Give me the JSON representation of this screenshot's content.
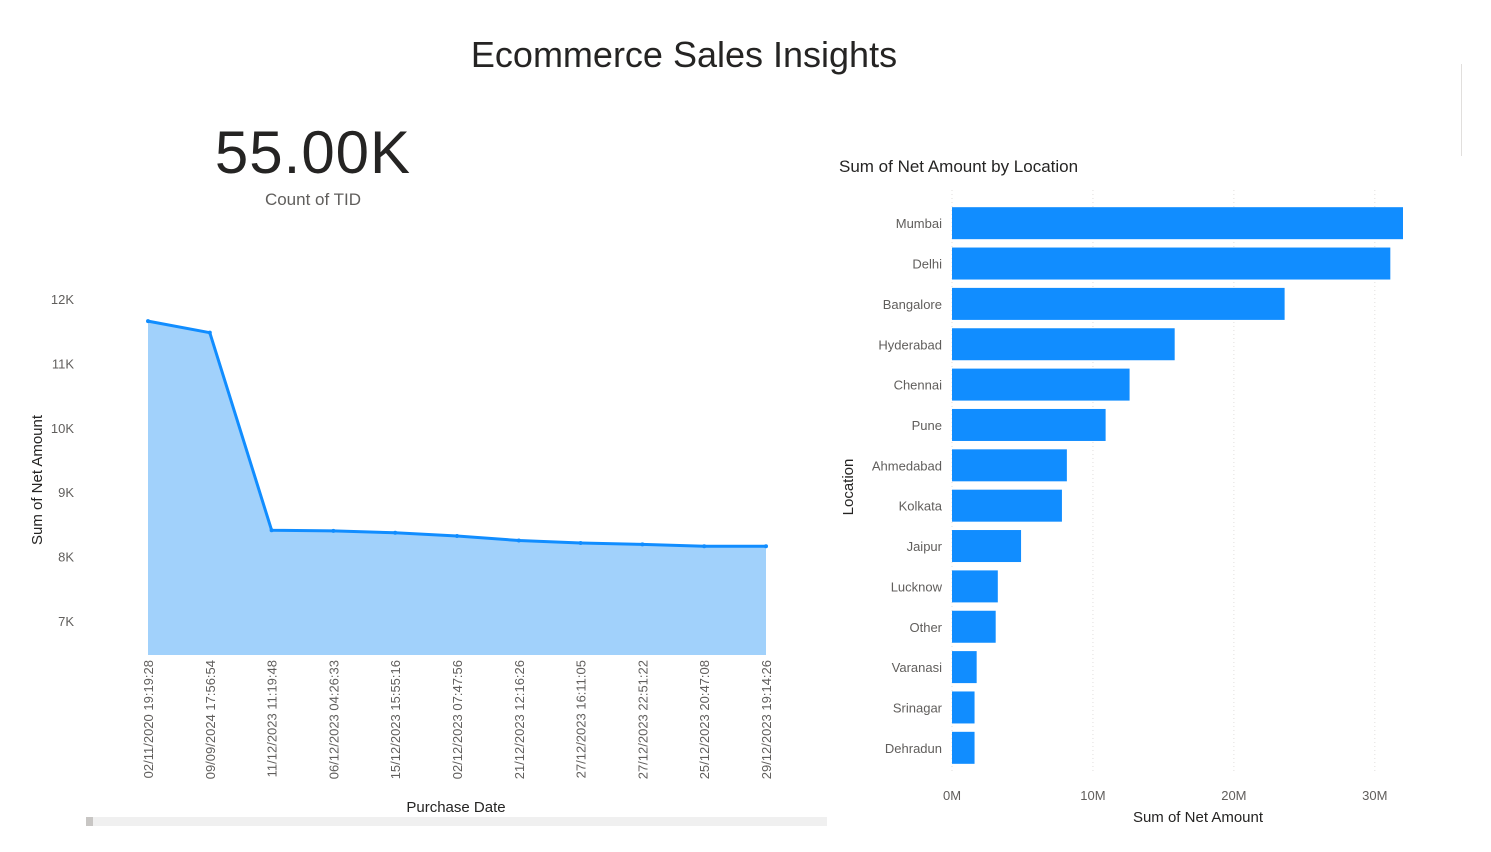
{
  "report": {
    "title": "Ecommerce Sales Insights"
  },
  "kpi": {
    "value": "55.00K",
    "label": "Count of TID"
  },
  "colors": {
    "bar": "#118dff",
    "area_fill": "#a1d1fb",
    "area_line": "#118dff",
    "grid": "#e1dfdd"
  },
  "chart_data": [
    {
      "type": "area",
      "title": "",
      "xlabel": "Purchase Date",
      "ylabel": "Sum of Net Amount",
      "x": [
        "02/11/2020 19:19:28",
        "09/09/2024 17:56:54",
        "11/12/2023 11:19:48",
        "06/12/2023 04:26:33",
        "15/12/2023 15:55:16",
        "02/12/2023 07:47:56",
        "21/12/2023 12:16:26",
        "27/12/2023 16:11:05",
        "27/12/2023 22:51:22",
        "25/12/2023 20:47:08",
        "29/12/2023 19:14:26"
      ],
      "values": [
        11660,
        11480,
        8410,
        8400,
        8370,
        8320,
        8250,
        8210,
        8190,
        8160,
        8160
      ],
      "yticks": [
        12000,
        11000,
        10000,
        9000,
        8000,
        7000
      ],
      "ytick_labels": [
        "12K",
        "11K",
        "10K",
        "9K",
        "8K",
        "7K"
      ],
      "ylim": [
        6470,
        12330
      ],
      "grid": false
    },
    {
      "type": "bar",
      "orientation": "horizontal",
      "title": "Sum of Net Amount by Location",
      "xlabel": "Sum of Net Amount",
      "ylabel": "Location",
      "categories": [
        "Mumbai",
        "Delhi",
        "Bangalore",
        "Hyderabad",
        "Chennai",
        "Pune",
        "Ahmedabad",
        "Kolkata",
        "Jaipur",
        "Lucknow",
        "Other",
        "Varanasi",
        "Srinagar",
        "Dehradun"
      ],
      "values": [
        32000000,
        31100000,
        23600000,
        15800000,
        12600000,
        10900000,
        8150000,
        7800000,
        4900000,
        3250000,
        3100000,
        1750000,
        1600000,
        1600000
      ],
      "xticks": [
        0,
        10000000,
        20000000,
        30000000
      ],
      "xtick_labels": [
        "0M",
        "10M",
        "20M",
        "30M"
      ],
      "xlim": [
        0,
        32000000
      ],
      "grid": true
    }
  ]
}
